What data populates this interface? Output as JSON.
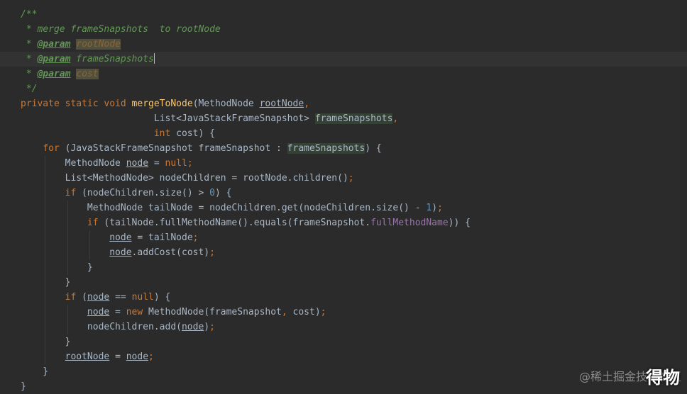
{
  "editor": {
    "lines": [
      [
        {
          "t": "/**",
          "c": "comment"
        }
      ],
      [
        {
          "t": " * merge frameSnapshots  to rootNode",
          "c": "comment"
        }
      ],
      [
        {
          "t": " * ",
          "c": "comment"
        },
        {
          "t": "@param",
          "c": "tag"
        },
        {
          "t": " ",
          "c": "comment"
        },
        {
          "t": "rootNode",
          "c": "pref"
        }
      ],
      [
        {
          "t": " * ",
          "c": "comment"
        },
        {
          "t": "@param",
          "c": "tag"
        },
        {
          "t": " ",
          "c": "comment"
        },
        {
          "t": "frameSnapshots",
          "c": "comment"
        }
      ],
      [
        {
          "t": " * ",
          "c": "comment"
        },
        {
          "t": "@param",
          "c": "tag"
        },
        {
          "t": " ",
          "c": "comment"
        },
        {
          "t": "cost",
          "c": "pref"
        }
      ],
      [
        {
          "t": " */",
          "c": "comment"
        }
      ],
      [
        {
          "t": "private static void ",
          "c": "kw"
        },
        {
          "t": "mergeToNode",
          "c": "fn"
        },
        {
          "t": "(MethodNode ",
          "c": "plain"
        },
        {
          "t": "rootNode",
          "c": "ul"
        },
        {
          "t": ",",
          "c": "kw"
        }
      ],
      [
        {
          "t": "                        List<JavaStackFrameSnapshot> ",
          "c": "plain"
        },
        {
          "t": "frameSnapshots",
          "c": "hl"
        },
        {
          "t": ",",
          "c": "kw"
        }
      ],
      [
        {
          "t": "                        ",
          "c": "plain"
        },
        {
          "t": "int ",
          "c": "kw"
        },
        {
          "t": "cost) {",
          "c": "plain"
        }
      ],
      [
        {
          "t": "    ",
          "c": "plain"
        },
        {
          "t": "for ",
          "c": "kw"
        },
        {
          "t": "(JavaStackFrameSnapshot frameSnapshot : ",
          "c": "plain"
        },
        {
          "t": "frameSnapshots",
          "c": "hl"
        },
        {
          "t": ") {",
          "c": "plain"
        }
      ],
      [
        {
          "t": "        MethodNode ",
          "c": "plain"
        },
        {
          "t": "node",
          "c": "ul"
        },
        {
          "t": " = ",
          "c": "plain"
        },
        {
          "t": "null",
          "c": "kw"
        },
        {
          "t": ";",
          "c": "kw"
        }
      ],
      [
        {
          "t": "        List<MethodNode> nodeChildren = rootNode.children()",
          "c": "plain"
        },
        {
          "t": ";",
          "c": "kw"
        }
      ],
      [
        {
          "t": "        ",
          "c": "plain"
        },
        {
          "t": "if ",
          "c": "kw"
        },
        {
          "t": "(nodeChildren.size() > ",
          "c": "plain"
        },
        {
          "t": "0",
          "c": "num"
        },
        {
          "t": ") {",
          "c": "plain"
        }
      ],
      [
        {
          "t": "            MethodNode tailNode = nodeChildren.get(nodeChildren.size() - ",
          "c": "plain"
        },
        {
          "t": "1",
          "c": "num"
        },
        {
          "t": ")",
          "c": "plain"
        },
        {
          "t": ";",
          "c": "kw"
        }
      ],
      [
        {
          "t": "            ",
          "c": "plain"
        },
        {
          "t": "if ",
          "c": "kw"
        },
        {
          "t": "(tailNode.fullMethodName().equals(frameSnapshot.",
          "c": "plain"
        },
        {
          "t": "fullMethodName",
          "c": "field"
        },
        {
          "t": ")) {",
          "c": "plain"
        }
      ],
      [
        {
          "t": "                ",
          "c": "plain"
        },
        {
          "t": "node",
          "c": "ul"
        },
        {
          "t": " = tailNode",
          "c": "plain"
        },
        {
          "t": ";",
          "c": "kw"
        }
      ],
      [
        {
          "t": "                ",
          "c": "plain"
        },
        {
          "t": "node",
          "c": "ul"
        },
        {
          "t": ".addCost(cost)",
          "c": "plain"
        },
        {
          "t": ";",
          "c": "kw"
        }
      ],
      [
        {
          "t": "            }",
          "c": "plain"
        }
      ],
      [
        {
          "t": "        }",
          "c": "plain"
        }
      ],
      [
        {
          "t": "        ",
          "c": "plain"
        },
        {
          "t": "if ",
          "c": "kw"
        },
        {
          "t": "(",
          "c": "plain"
        },
        {
          "t": "node",
          "c": "ul"
        },
        {
          "t": " == ",
          "c": "plain"
        },
        {
          "t": "null",
          "c": "kw"
        },
        {
          "t": ") {",
          "c": "plain"
        }
      ],
      [
        {
          "t": "            ",
          "c": "plain"
        },
        {
          "t": "node",
          "c": "ul"
        },
        {
          "t": " = ",
          "c": "plain"
        },
        {
          "t": "new ",
          "c": "kw"
        },
        {
          "t": "MethodNode(frameSnapshot",
          "c": "plain"
        },
        {
          "t": ", ",
          "c": "kw"
        },
        {
          "t": "cost)",
          "c": "plain"
        },
        {
          "t": ";",
          "c": "kw"
        }
      ],
      [
        {
          "t": "            nodeChildren.add(",
          "c": "plain"
        },
        {
          "t": "node",
          "c": "ul"
        },
        {
          "t": ")",
          "c": "plain"
        },
        {
          "t": ";",
          "c": "kw"
        }
      ],
      [
        {
          "t": "        }",
          "c": "plain"
        }
      ],
      [
        {
          "t": "        ",
          "c": "plain"
        },
        {
          "t": "rootNode",
          "c": "ul"
        },
        {
          "t": " = ",
          "c": "plain"
        },
        {
          "t": "node",
          "c": "ul"
        },
        {
          "t": ";",
          "c": "kw"
        }
      ],
      [
        {
          "t": "    }",
          "c": "plain"
        }
      ],
      [
        {
          "t": "}",
          "c": "plain"
        }
      ]
    ],
    "current_line": 3,
    "caret_after_token": 3
  },
  "watermark": {
    "text": "@稀土掘金技术社区",
    "overlay": "得物"
  }
}
